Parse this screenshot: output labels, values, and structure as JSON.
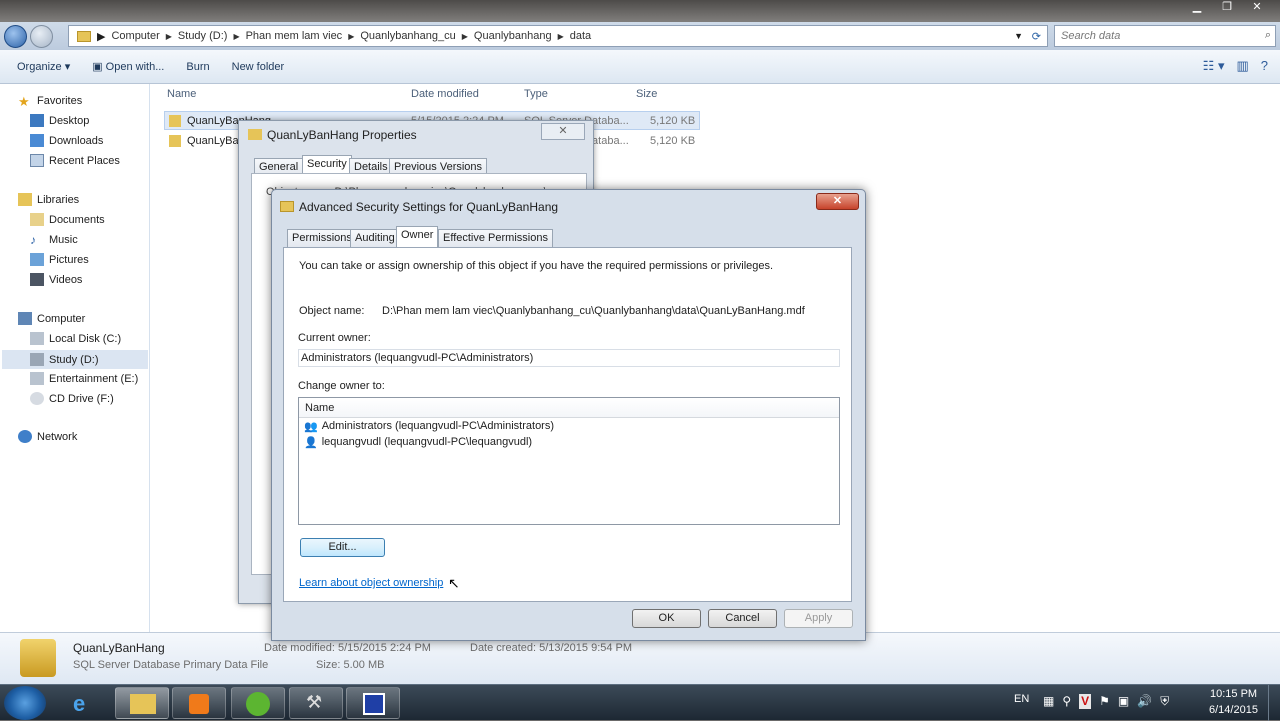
{
  "window": {
    "breadcrumb": [
      "Computer",
      "Study (D:)",
      "Phan mem lam viec",
      "Quanlybanhang_cu",
      "Quanlybanhang",
      "data"
    ],
    "search_placeholder": "Search data"
  },
  "toolbar": {
    "organize": "Organize ▾",
    "open_with": "Open with...",
    "burn": "Burn",
    "new_folder": "New folder"
  },
  "nav": {
    "favorites": "Favorites",
    "desktop": "Desktop",
    "downloads": "Downloads",
    "recent_places": "Recent Places",
    "libraries": "Libraries",
    "documents": "Documents",
    "music": "Music",
    "pictures": "Pictures",
    "videos": "Videos",
    "computer": "Computer",
    "local_disk": "Local Disk (C:)",
    "study": "Study (D:)",
    "entertainment": "Entertainment (E:)",
    "cd_drive": "CD Drive (F:)",
    "network": "Network"
  },
  "files": {
    "headers": [
      "Name",
      "Date modified",
      "Type",
      "Size"
    ],
    "rows": [
      {
        "name": "QuanLyBanHang",
        "date": "5/15/2015 2:24 PM",
        "type": "SQL Server Databa...",
        "size": "5,120 KB"
      },
      {
        "name": "QuanLyBanHang_log",
        "date": "",
        "type": "SQL Server Databa...",
        "size": "5,120 KB"
      }
    ]
  },
  "details": {
    "name": "QuanLyBanHang",
    "type": "SQL Server Database Primary Data File",
    "date_modified": "Date modified: 5/15/2015 2:24 PM",
    "size": "Size: 5.00 MB",
    "date_created": "Date created: 5/13/2015 9:54 PM"
  },
  "properties_dialog": {
    "title": "QuanLyBanHang Properties",
    "close": "✕",
    "tabs": [
      "General",
      "Security",
      "Details",
      "Previous Versions"
    ],
    "object_prefix": "Object name:   D:\\Phan mem lam viec\\Quanlybanhang_cu\\"
  },
  "advanced_dialog": {
    "title": "Advanced Security Settings for QuanLyBanHang",
    "close": "✕",
    "tabs": [
      "Permissions",
      "Auditing",
      "Owner",
      "Effective Permissions"
    ],
    "intro": "You can take or assign ownership of this object if you have the required permissions or privileges.",
    "object_name_label": "Object name:",
    "object_name_value": "D:\\Phan mem lam viec\\Quanlybanhang_cu\\Quanlybanhang\\data\\QuanLyBanHang.mdf",
    "current_owner_label": "Current owner:",
    "current_owner_value": "Administrators (lequangvudl-PC\\Administrators)",
    "change_owner_label": "Change owner to:",
    "list_header": "Name",
    "owners": [
      "Administrators (lequangvudl-PC\\Administrators)",
      "lequangvudl (lequangvudl-PC\\lequangvudl)"
    ],
    "edit_button": "Edit...",
    "learn_link": "Learn about object ownership",
    "ok": "OK",
    "cancel": "Cancel",
    "apply": "Apply"
  },
  "taskbar": {
    "language": "EN",
    "time": "10:15 PM",
    "date": "6/14/2015"
  }
}
